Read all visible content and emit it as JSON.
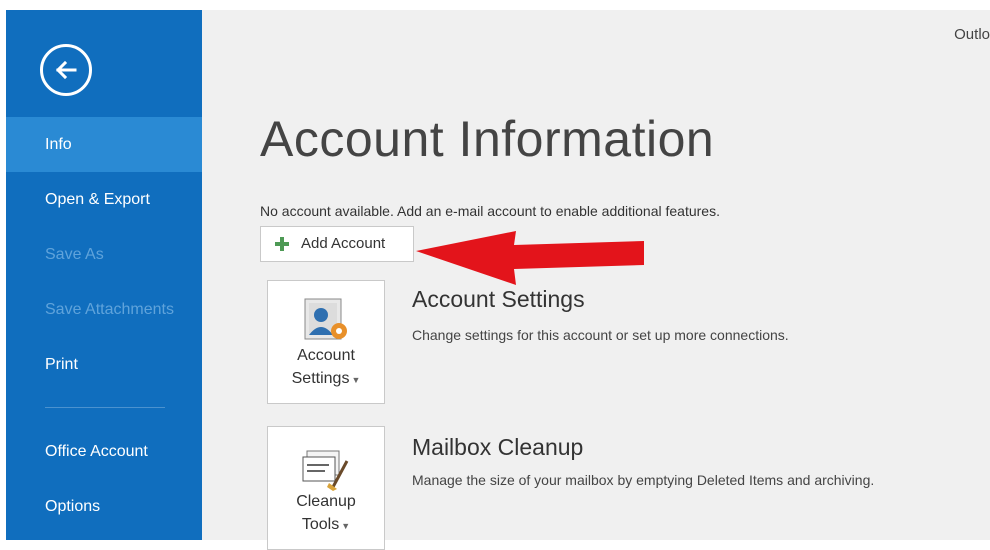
{
  "window": {
    "app_name": "Outlo"
  },
  "sidebar": {
    "items": [
      {
        "label": "Info"
      },
      {
        "label": "Open & Export"
      },
      {
        "label": "Save As"
      },
      {
        "label": "Save Attachments"
      },
      {
        "label": "Print"
      },
      {
        "label": "Office Account"
      },
      {
        "label": "Options"
      }
    ]
  },
  "main": {
    "title": "Account Information",
    "notice": "No account available. Add an e-mail account to enable additional features.",
    "add_account_label": "Add Account",
    "sections": [
      {
        "tile_line1": "Account",
        "tile_line2": "Settings",
        "title": "Account Settings",
        "description": "Change settings for this account or set up more connections."
      },
      {
        "tile_line1": "Cleanup",
        "tile_line2": "Tools",
        "title": "Mailbox Cleanup",
        "description": "Manage the size of your mailbox by emptying Deleted Items and archiving."
      }
    ]
  },
  "colors": {
    "sidebar": "#106ebe",
    "sidebar_active": "#2a8ad4",
    "main_bg": "#f0f0f0",
    "annotation_arrow": "#e3141b"
  },
  "icons": {
    "back": "back-arrow-icon",
    "add": "plus-icon",
    "account_settings": "account-settings-icon",
    "cleanup_tools": "cleanup-tools-icon",
    "annotation": "red-arrow-icon"
  }
}
